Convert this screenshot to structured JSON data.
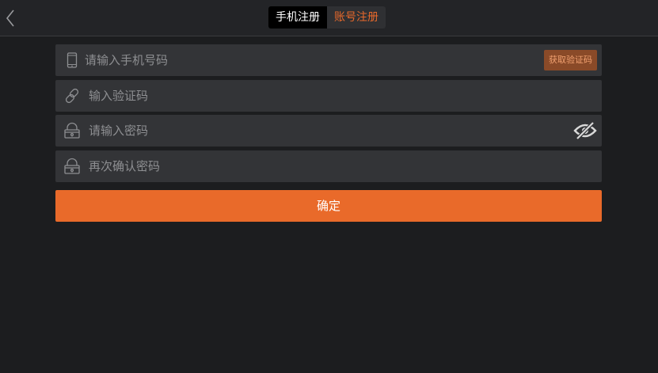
{
  "header": {
    "back_icon": "chevron-left-icon",
    "tabs": [
      {
        "label": "手机注册",
        "active": true
      },
      {
        "label": "账号注册",
        "active": false
      }
    ]
  },
  "form": {
    "phone": {
      "icon": "mobile-phone-icon",
      "placeholder": "请输入手机号码",
      "value": ""
    },
    "get_code_label": "获取验证码",
    "code": {
      "icon": "link-icon",
      "placeholder": "输入验证码",
      "value": ""
    },
    "password": {
      "icon": "lock-icon",
      "placeholder": "请输入密码",
      "value": "",
      "toggle_icon": "eye-off-icon"
    },
    "confirm_password": {
      "icon": "lock-icon",
      "placeholder": "再次确认密码",
      "value": ""
    },
    "submit_label": "确定"
  },
  "colors": {
    "background": "#1c1d1f",
    "field": "#333437",
    "accent": "#e96a2a",
    "tab_active_bg": "#000000",
    "tab_inactive_text": "#e8692b"
  }
}
